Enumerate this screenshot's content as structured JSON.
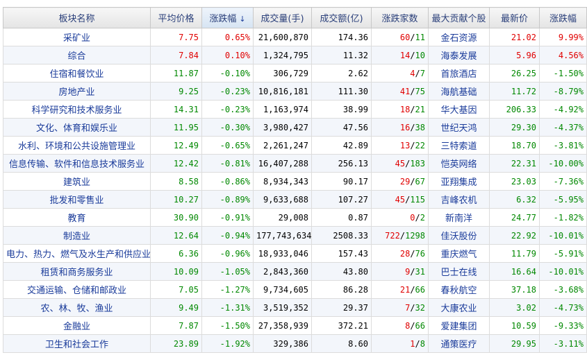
{
  "headers": {
    "name": "板块名称",
    "avg_price": "平均价格",
    "change_pct": "涨跌幅",
    "sort_arrow": "↓",
    "volume": "成交量(手)",
    "amount": "成交额(亿)",
    "up_down": "涨跌家数",
    "top_stock": "最大贡献个股",
    "last_price": "最新价",
    "stock_change": "涨跌幅"
  },
  "colors": {
    "up": "#e00000",
    "down": "#008800"
  },
  "rows": [
    {
      "name": "采矿业",
      "avg": "7.75",
      "pct": "0.65%",
      "vol": "21,600,870",
      "amt": "174.36",
      "up": "60",
      "down": "11",
      "stock": "金石资源",
      "price": "21.02",
      "schg": "9.99%",
      "dir": "up",
      "sdir": "up"
    },
    {
      "name": "综合",
      "avg": "7.84",
      "pct": "0.10%",
      "vol": "1,324,795",
      "amt": "11.32",
      "up": "14",
      "down": "10",
      "stock": "海泰发展",
      "price": "5.96",
      "schg": "4.56%",
      "dir": "up",
      "sdir": "up"
    },
    {
      "name": "住宿和餐饮业",
      "avg": "11.87",
      "pct": "-0.10%",
      "vol": "306,729",
      "amt": "2.62",
      "up": "4",
      "down": "7",
      "stock": "首旅酒店",
      "price": "26.25",
      "schg": "-1.50%",
      "dir": "down",
      "sdir": "down"
    },
    {
      "name": "房地产业",
      "avg": "9.25",
      "pct": "-0.23%",
      "vol": "10,816,181",
      "amt": "111.30",
      "up": "41",
      "down": "75",
      "stock": "海航基础",
      "price": "11.72",
      "schg": "-8.79%",
      "dir": "down",
      "sdir": "down"
    },
    {
      "name": "科学研究和技术服务业",
      "avg": "14.31",
      "pct": "-0.23%",
      "vol": "1,163,974",
      "amt": "38.99",
      "up": "18",
      "down": "21",
      "stock": "华大基因",
      "price": "206.33",
      "schg": "-4.92%",
      "dir": "down",
      "sdir": "down"
    },
    {
      "name": "文化、体育和娱乐业",
      "avg": "11.95",
      "pct": "-0.30%",
      "vol": "3,980,427",
      "amt": "47.56",
      "up": "16",
      "down": "38",
      "stock": "世纪天鸿",
      "price": "29.30",
      "schg": "-4.37%",
      "dir": "down",
      "sdir": "down"
    },
    {
      "name": "水利、环境和公共设施管理业",
      "avg": "12.49",
      "pct": "-0.65%",
      "vol": "2,261,247",
      "amt": "42.89",
      "up": "13",
      "down": "22",
      "stock": "三特索道",
      "price": "18.70",
      "schg": "-3.81%",
      "dir": "down",
      "sdir": "down"
    },
    {
      "name": "信息传输、软件和信息技术服务业",
      "avg": "12.42",
      "pct": "-0.81%",
      "vol": "16,407,288",
      "amt": "256.13",
      "up": "45",
      "down": "183",
      "stock": "恺英网络",
      "price": "22.31",
      "schg": "-10.00%",
      "dir": "down",
      "sdir": "down"
    },
    {
      "name": "建筑业",
      "avg": "8.58",
      "pct": "-0.86%",
      "vol": "8,934,343",
      "amt": "90.17",
      "up": "29",
      "down": "67",
      "stock": "亚翔集成",
      "price": "23.03",
      "schg": "-7.36%",
      "dir": "down",
      "sdir": "down"
    },
    {
      "name": "批发和零售业",
      "avg": "10.27",
      "pct": "-0.89%",
      "vol": "9,633,688",
      "amt": "107.27",
      "up": "45",
      "down": "115",
      "stock": "吉峰农机",
      "price": "6.32",
      "schg": "-5.95%",
      "dir": "down",
      "sdir": "down"
    },
    {
      "name": "教育",
      "avg": "30.90",
      "pct": "-0.91%",
      "vol": "29,008",
      "amt": "0.87",
      "up": "0",
      "down": "2",
      "stock": "新南洋",
      "price": "24.77",
      "schg": "-1.82%",
      "dir": "down",
      "sdir": "down"
    },
    {
      "name": "制造业",
      "avg": "12.64",
      "pct": "-0.94%",
      "vol": "177,743,634",
      "amt": "2508.33",
      "up": "722",
      "down": "1298",
      "stock": "佳沃股份",
      "price": "22.92",
      "schg": "-10.01%",
      "dir": "down",
      "sdir": "down"
    },
    {
      "name": "电力、热力、燃气及水生产和供应业",
      "avg": "6.36",
      "pct": "-0.96%",
      "vol": "18,933,046",
      "amt": "157.43",
      "up": "28",
      "down": "76",
      "stock": "重庆燃气",
      "price": "11.79",
      "schg": "-5.91%",
      "dir": "down",
      "sdir": "down"
    },
    {
      "name": "租赁和商务服务业",
      "avg": "10.09",
      "pct": "-1.05%",
      "vol": "2,843,360",
      "amt": "43.80",
      "up": "9",
      "down": "31",
      "stock": "巴士在线",
      "price": "16.64",
      "schg": "-10.01%",
      "dir": "down",
      "sdir": "down"
    },
    {
      "name": "交通运输、仓储和邮政业",
      "avg": "7.05",
      "pct": "-1.27%",
      "vol": "9,734,605",
      "amt": "86.28",
      "up": "21",
      "down": "66",
      "stock": "春秋航空",
      "price": "37.18",
      "schg": "-3.68%",
      "dir": "down",
      "sdir": "down"
    },
    {
      "name": "农、林、牧、渔业",
      "avg": "9.49",
      "pct": "-1.31%",
      "vol": "3,519,352",
      "amt": "29.37",
      "up": "7",
      "down": "32",
      "stock": "大康农业",
      "price": "3.02",
      "schg": "-4.73%",
      "dir": "down",
      "sdir": "down"
    },
    {
      "name": "金融业",
      "avg": "7.87",
      "pct": "-1.50%",
      "vol": "27,358,939",
      "amt": "372.21",
      "up": "8",
      "down": "66",
      "stock": "爱建集团",
      "price": "10.59",
      "schg": "-9.33%",
      "dir": "down",
      "sdir": "down"
    },
    {
      "name": "卫生和社会工作",
      "avg": "23.89",
      "pct": "-1.92%",
      "vol": "329,386",
      "amt": "8.60",
      "up": "1",
      "down": "8",
      "stock": "通策医疗",
      "price": "29.95",
      "schg": "-3.11%",
      "dir": "down",
      "sdir": "down"
    }
  ]
}
